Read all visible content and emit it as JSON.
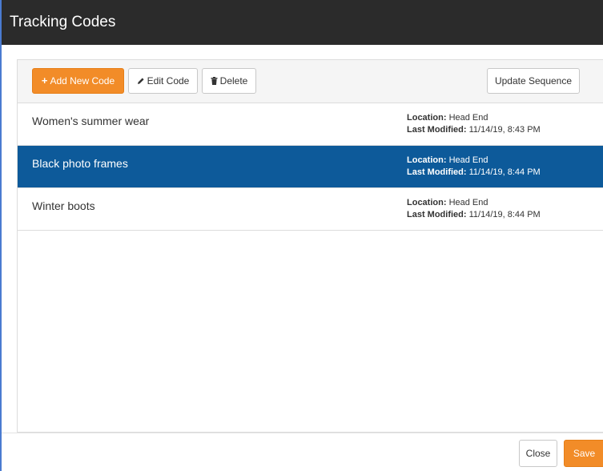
{
  "window": {
    "title": "Tracking Codes"
  },
  "toolbar": {
    "add_icon": "+",
    "add_label": "Add New Code",
    "edit_icon": "pencil-icon",
    "edit_label": "Edit Code",
    "delete_icon": "trash-icon",
    "delete_label": "Delete",
    "update_sequence_label": "Update Sequence"
  },
  "list": {
    "location_label": "Location:",
    "modified_label": "Last Modified:",
    "items": [
      {
        "name": "Women's summer wear",
        "location": "Head End",
        "last_modified": "11/14/19, 8:43 PM",
        "selected": false
      },
      {
        "name": "Black photo frames",
        "location": "Head End",
        "last_modified": "11/14/19, 8:44 PM",
        "selected": true
      },
      {
        "name": "Winter boots",
        "location": "Head End",
        "last_modified": "11/14/19, 8:44 PM",
        "selected": false
      }
    ]
  },
  "footer": {
    "close_label": "Close",
    "save_label": "Save"
  },
  "colors": {
    "title_bar": "#2b2b2b",
    "primary_orange": "#f28c28",
    "selected_row": "#0d5a9a"
  }
}
